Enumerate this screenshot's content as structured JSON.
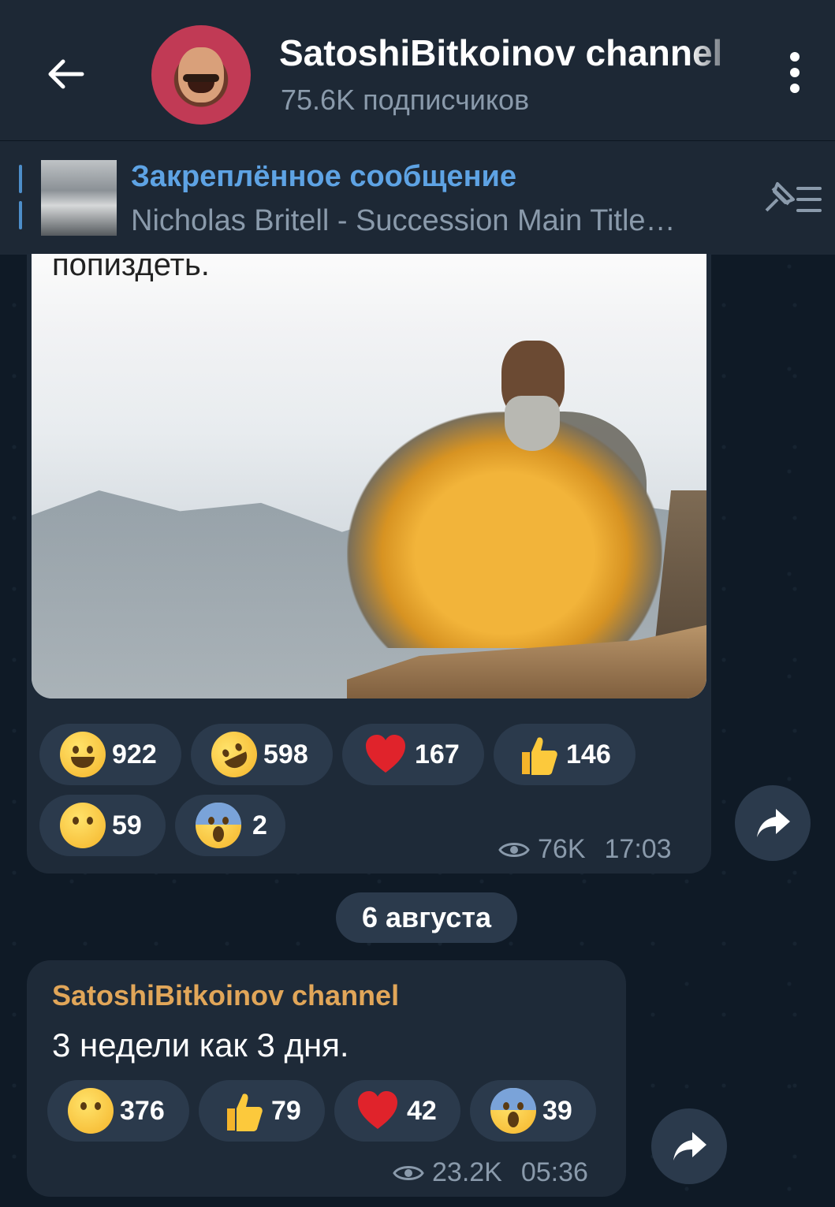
{
  "header": {
    "title": "SatoshiBitkoinov channel",
    "subscribers": "75.6K подписчиков"
  },
  "pinned": {
    "title": "Закреплённое сообщение",
    "text": "Nicholas Britell - Succession Main Title…"
  },
  "message1": {
    "caption": "попиздеть.",
    "reactions": [
      {
        "emoji": "grinning-face",
        "count": "922"
      },
      {
        "emoji": "rofl-face",
        "count": "598"
      },
      {
        "emoji": "red-heart",
        "count": "167"
      },
      {
        "emoji": "thumbs-up",
        "count": "146"
      },
      {
        "emoji": "thinking-face",
        "count": "59"
      },
      {
        "emoji": "screaming-face",
        "count": "2"
      }
    ],
    "views": "76K",
    "time": "17:03"
  },
  "date_separator": "6 августа",
  "message2": {
    "author": "SatoshiBitkoinov channel",
    "text": "3 недели как 3 дня.",
    "reactions": [
      {
        "emoji": "thinking-face",
        "count": "376"
      },
      {
        "emoji": "thumbs-up",
        "count": "79"
      },
      {
        "emoji": "red-heart",
        "count": "42"
      },
      {
        "emoji": "screaming-face",
        "count": "39"
      }
    ],
    "views": "23.2K",
    "time": "05:36"
  },
  "colors": {
    "background": "#0f1a26",
    "bar": "#1d2835",
    "bubble": "#1e2a38",
    "pill": "#2b3a4c",
    "accent_blue": "#5ea3e4",
    "author_orange": "#e1a659"
  }
}
